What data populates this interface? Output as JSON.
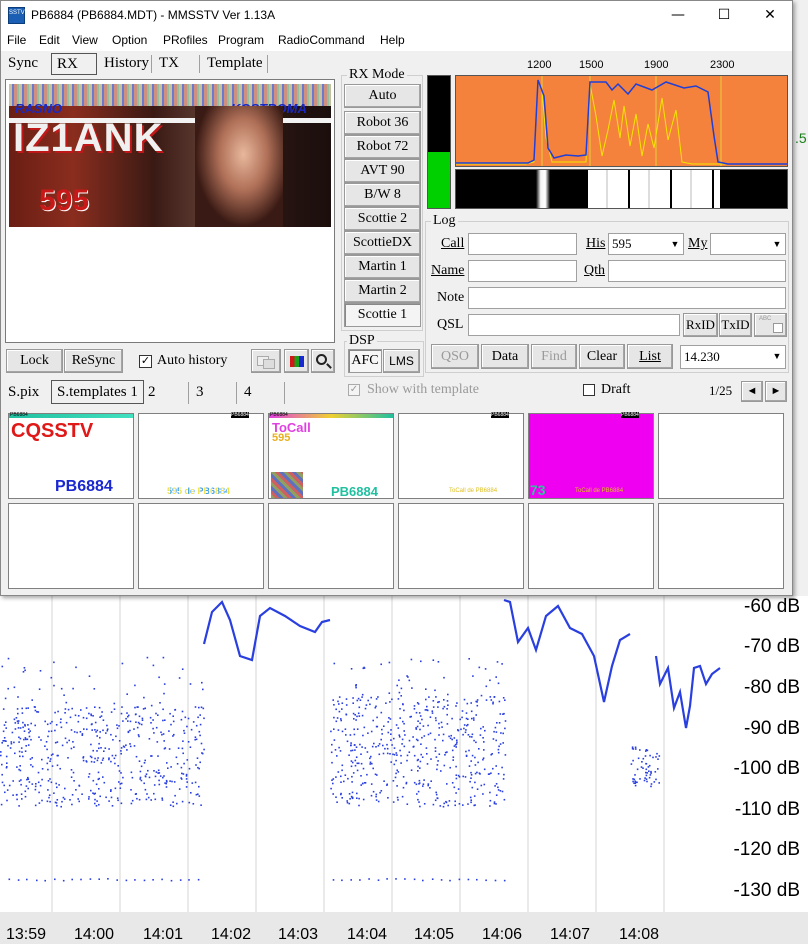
{
  "window": {
    "title": "PB6884 (PB6884.MDT) - MMSSTV Ver 1.13A",
    "icon_text": "SSTV",
    "minimize": "—",
    "maximize": "☐",
    "close": "✕"
  },
  "menu": [
    "File",
    "Edit",
    "View",
    "Option",
    "PRofiles",
    "Program",
    "RadioCommand",
    "Help"
  ],
  "tabs": [
    "Sync",
    "RX",
    "History",
    "TX",
    "Template"
  ],
  "rx_image": {
    "top_left_text": "RASNO",
    "top_right_text": "KOSTROMA",
    "callsign": "IZ1ANK",
    "number": "595"
  },
  "rx_buttons": {
    "lock": "Lock",
    "resync": "ReSync",
    "auto_history": "Auto history",
    "auto_history_checked": true
  },
  "rx_mode": {
    "title": "RX Mode",
    "modes": [
      "Auto",
      "Robot 36",
      "Robot 72",
      "AVT 90",
      "B/W 8",
      "Scottie 2",
      "ScottieDX",
      "Martin 1",
      "Martin 2",
      "Scottie 1"
    ],
    "selected": "Scottie 1"
  },
  "dsp": {
    "title": "DSP",
    "afc": "AFC",
    "lms": "LMS"
  },
  "spectrum": {
    "freq_labels": [
      "1200",
      "1500",
      "1900",
      "2300"
    ]
  },
  "log": {
    "title": "Log",
    "call_label": "Call",
    "call_value": "",
    "his_label": "His",
    "his_value": "595",
    "my_label": "My",
    "my_value": "",
    "name_label": "Name",
    "name_value": "",
    "qth_label": "Qth",
    "qth_value": "",
    "note_label": "Note",
    "note_value": "",
    "qsl_label": "QSL",
    "qsl_value": "",
    "rxid": "RxID",
    "txid": "TxID",
    "qso": "QSO",
    "data": "Data",
    "find": "Find",
    "clear": "Clear",
    "list": "List",
    "frequency": "14.230"
  },
  "template_tabs": [
    "S.pix",
    "S.templates 1",
    "2",
    "3",
    "4"
  ],
  "template_options": {
    "show_with_template": "Show with template",
    "draft": "Draft",
    "page": "1/25",
    "prev": "◄",
    "next": "►"
  },
  "thumbnails": [
    {
      "header": "PB6884",
      "line1": "CQSSTV",
      "line2": "PB6884"
    },
    {
      "header": "PB6884",
      "line1": "",
      "line2": "595 de PB6884"
    },
    {
      "header": "PB6884",
      "line1": "ToCall",
      "line2": "PB6884",
      "line3": "595"
    },
    {
      "header": "PB6884",
      "line1": "",
      "line2": "ToCall de PB6884"
    },
    {
      "header": "PB6884",
      "line1": "73",
      "line2": "ToCall de PB6884"
    },
    {
      "header": "",
      "line1": "",
      "line2": ""
    }
  ],
  "background": {
    "db_labels": [
      "-60 dB",
      "-70 dB",
      "-80 dB",
      "-90 dB",
      "-100 dB",
      "-110 dB",
      "-120 dB",
      "-130 dB"
    ],
    "time_labels": [
      "13:59",
      "14:00",
      "14:01",
      "14:02",
      "14:03",
      "14:04",
      "14:05",
      "14:06",
      "14:07",
      "14:08"
    ],
    "right_edge_text": ".5"
  },
  "colors": {
    "spectrum_bg": "#f4823c",
    "trace_blue": "#1f3fd8",
    "trace_yellow": "#f2e600",
    "level_green": "#00d000",
    "plot_blue": "#2a3fe0"
  }
}
